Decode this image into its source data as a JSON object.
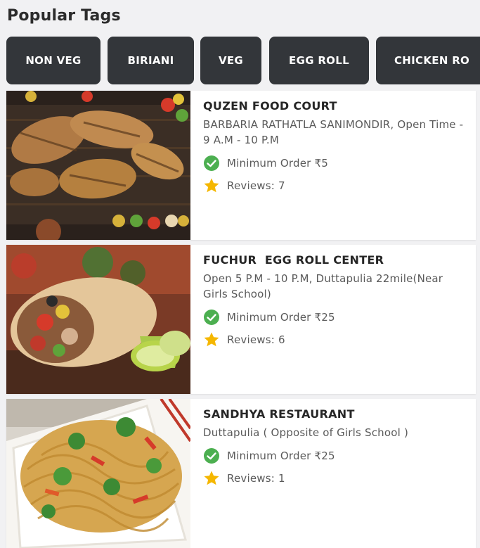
{
  "section": {
    "title": "Popular Tags"
  },
  "tags": [
    {
      "label": "NON VEG"
    },
    {
      "label": "BIRIANI"
    },
    {
      "label": "VEG"
    },
    {
      "label": "EGG ROLL"
    },
    {
      "label": "CHICKEN RO"
    }
  ],
  "restaurants": [
    {
      "name": "QUZEN FOOD COURT",
      "address": "BARBARIA RATHATLA SANIMONDIR, Open Time - 9 A.M - 10 P.M",
      "min_order": "Minimum Order ₹5",
      "reviews": "Reviews: 7",
      "image": "grilled-chicken-image"
    },
    {
      "name": "FUCHUR  EGG ROLL CENTER",
      "address": "Open 5 P.M - 10 P.M, Duttapulia 22mile(Near Girls School)",
      "min_order": "Minimum Order ₹25",
      "reviews": "Reviews: 6",
      "image": "egg-roll-image"
    },
    {
      "name": "SANDHYA RESTAURANT",
      "address": "Duttapulia ( Opposite of Girls School )",
      "min_order": "Minimum Order ₹25",
      "reviews": "Reviews: 1",
      "image": "noodles-image"
    }
  ],
  "icons": {
    "check": "check-circle-icon",
    "star": "star-icon"
  },
  "colors": {
    "tag_bg": "#33363a",
    "check_green": "#4caf50",
    "star_gold": "#f5b700"
  }
}
